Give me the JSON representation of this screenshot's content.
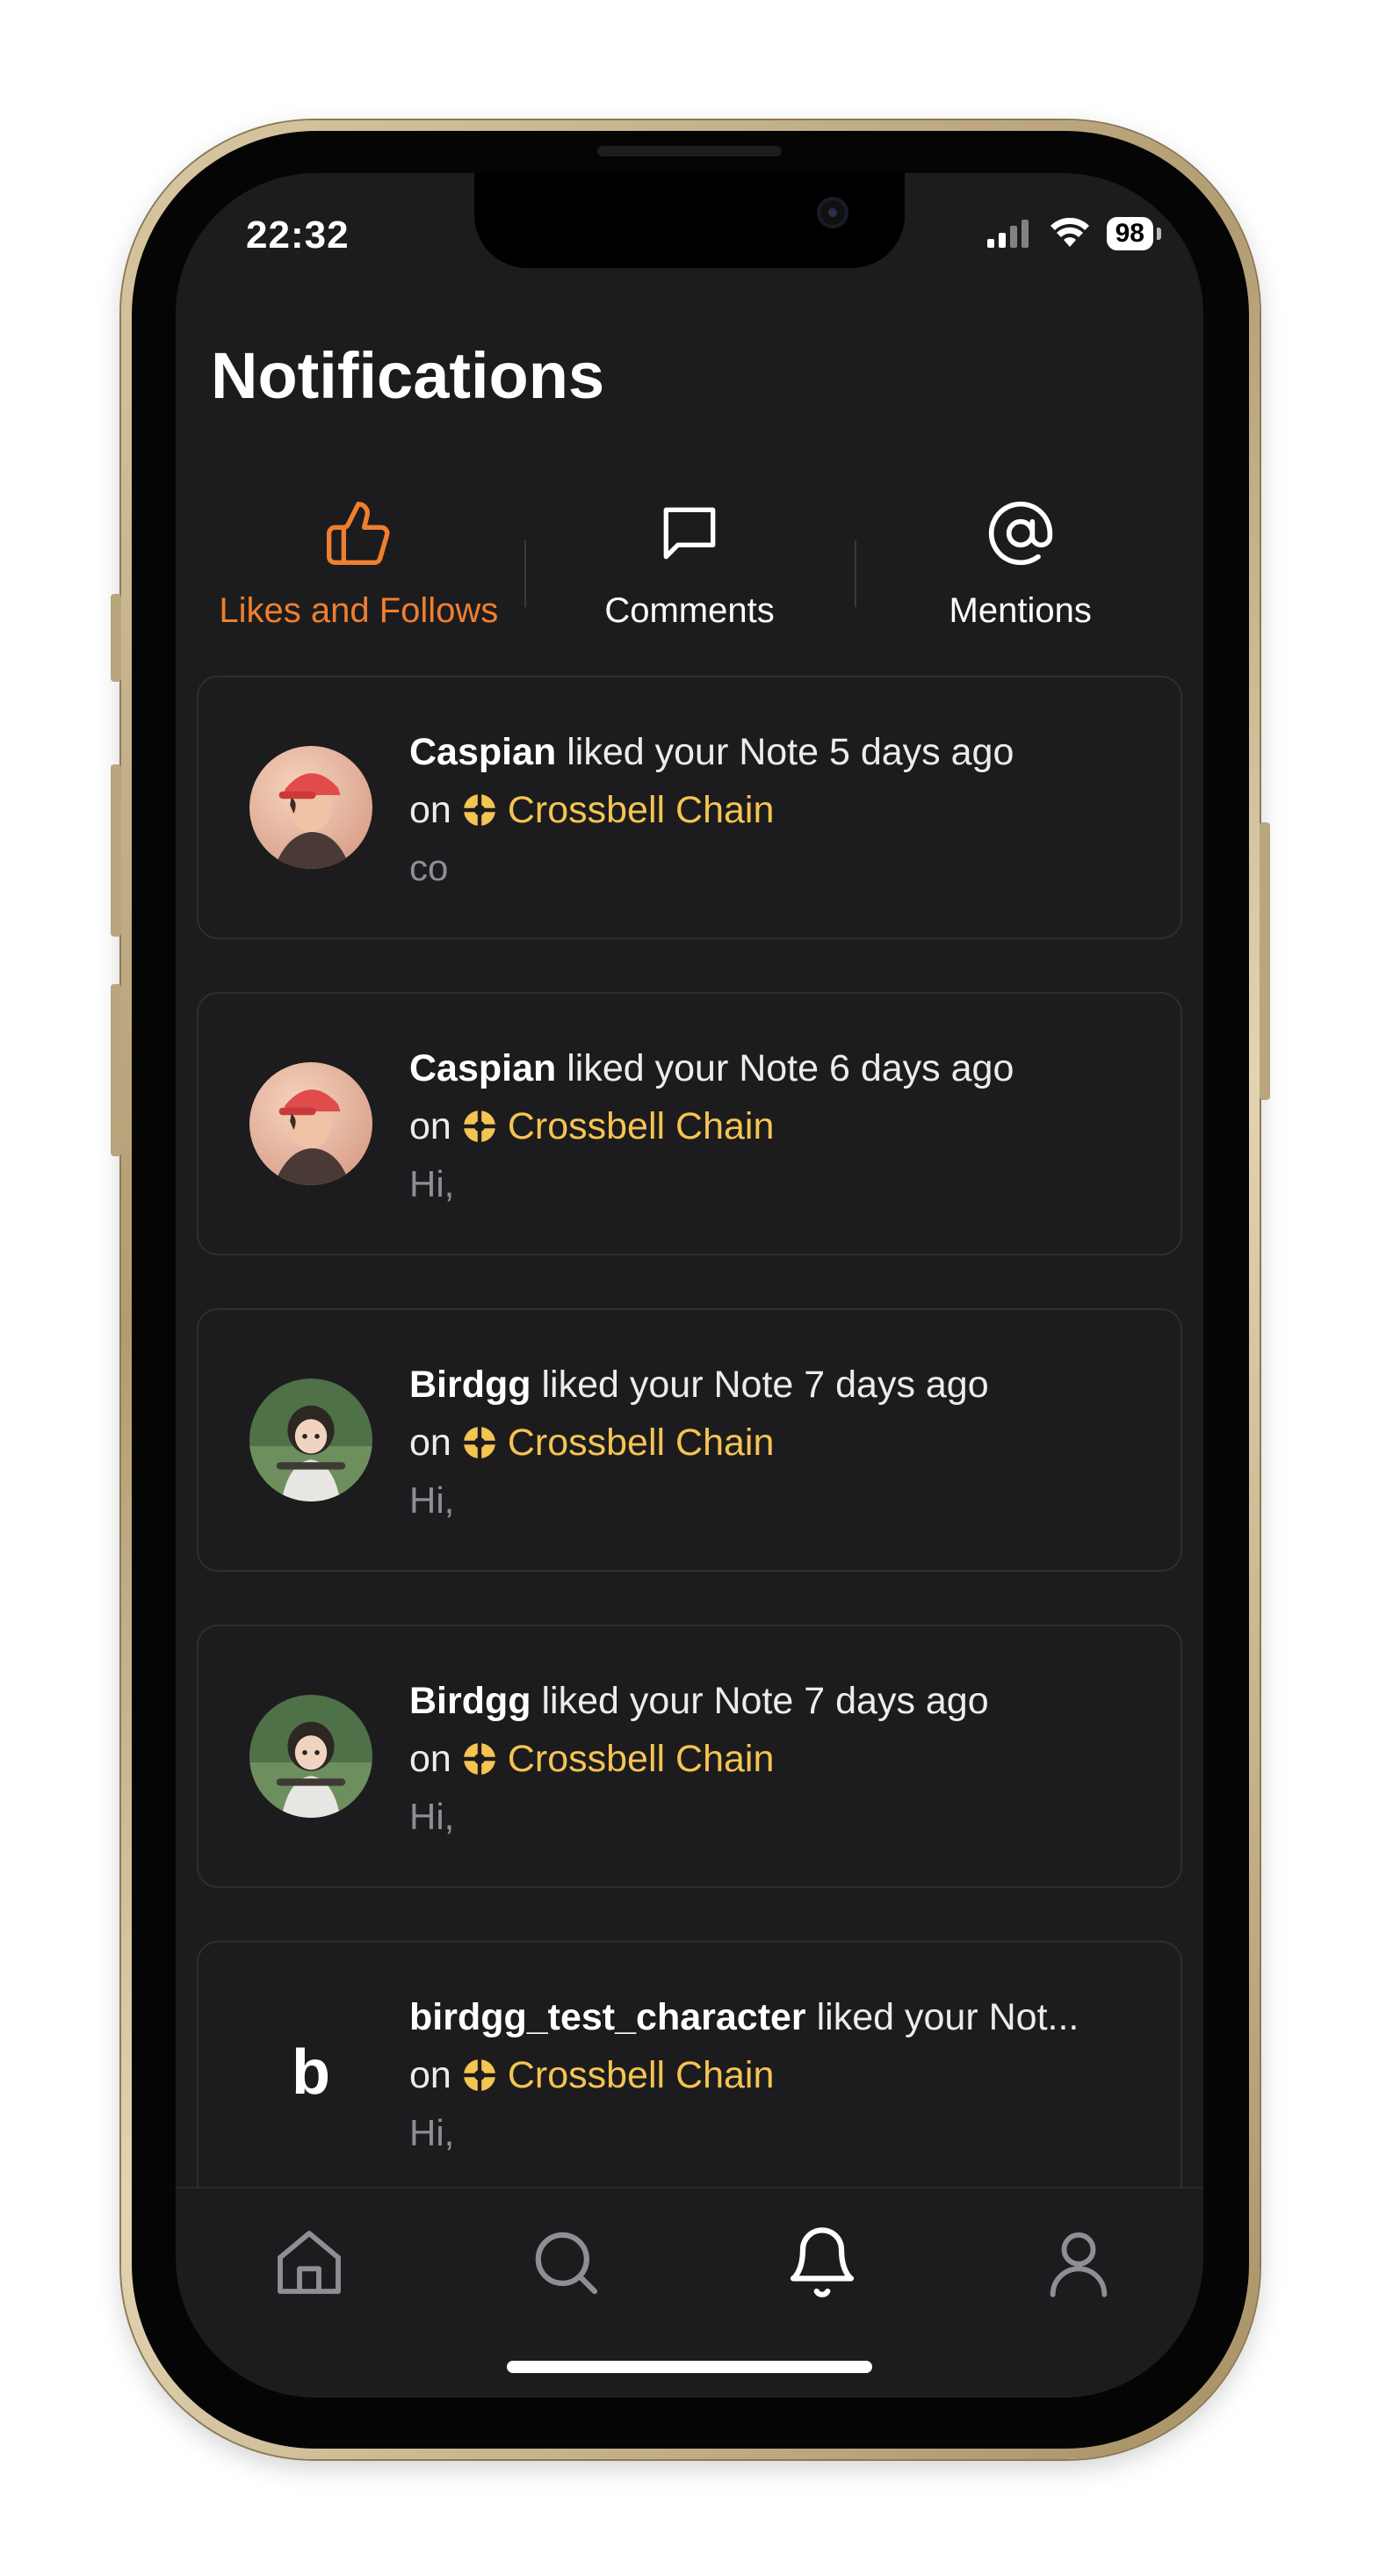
{
  "status_bar": {
    "time": "22:32",
    "battery": "98",
    "icons": [
      "cellular-signal-icon",
      "wifi-icon",
      "battery-icon"
    ]
  },
  "header": {
    "title": "Notifications"
  },
  "tabs": [
    {
      "label": "Likes and Follows",
      "icon": "thumbs-up-icon",
      "active": true
    },
    {
      "label": "Comments",
      "icon": "chat-bubble-icon",
      "active": false
    },
    {
      "label": "Mentions",
      "icon": "at-sign-icon",
      "active": false
    }
  ],
  "notifications": [
    {
      "actor": "Caspian",
      "action": " liked your Note 5 days ago",
      "on_label": "on",
      "chain": "Crossbell Chain",
      "excerpt": "co",
      "avatar": "caspian-avatar"
    },
    {
      "actor": "Caspian",
      "action": " liked your Note 6 days ago",
      "on_label": "on",
      "chain": "Crossbell Chain",
      "excerpt": "Hi,",
      "avatar": "caspian-avatar"
    },
    {
      "actor": "Birdgg",
      "action": " liked your Note 7 days ago",
      "on_label": "on",
      "chain": "Crossbell Chain",
      "excerpt": "Hi,",
      "avatar": "birdgg-avatar"
    },
    {
      "actor": "Birdgg",
      "action": " liked your Note 7 days ago",
      "on_label": "on",
      "chain": "Crossbell Chain",
      "excerpt": "Hi,",
      "avatar": "birdgg-avatar"
    },
    {
      "actor": "birdgg_test_character",
      "action": " liked your Not...",
      "on_label": "on",
      "chain": "Crossbell Chain",
      "excerpt": "Hi,",
      "avatar_letter": "b"
    }
  ],
  "tab_bar": [
    {
      "name": "home",
      "icon": "home-icon",
      "active": false
    },
    {
      "name": "search",
      "icon": "search-icon",
      "active": false
    },
    {
      "name": "notifications",
      "icon": "bell-icon",
      "active": true
    },
    {
      "name": "profile",
      "icon": "profile-icon",
      "active": false
    }
  ],
  "colors": {
    "background": "#1c1c1e",
    "accent": "#f07e2f",
    "chain": "#f5c451",
    "muted": "#8e8e93"
  }
}
